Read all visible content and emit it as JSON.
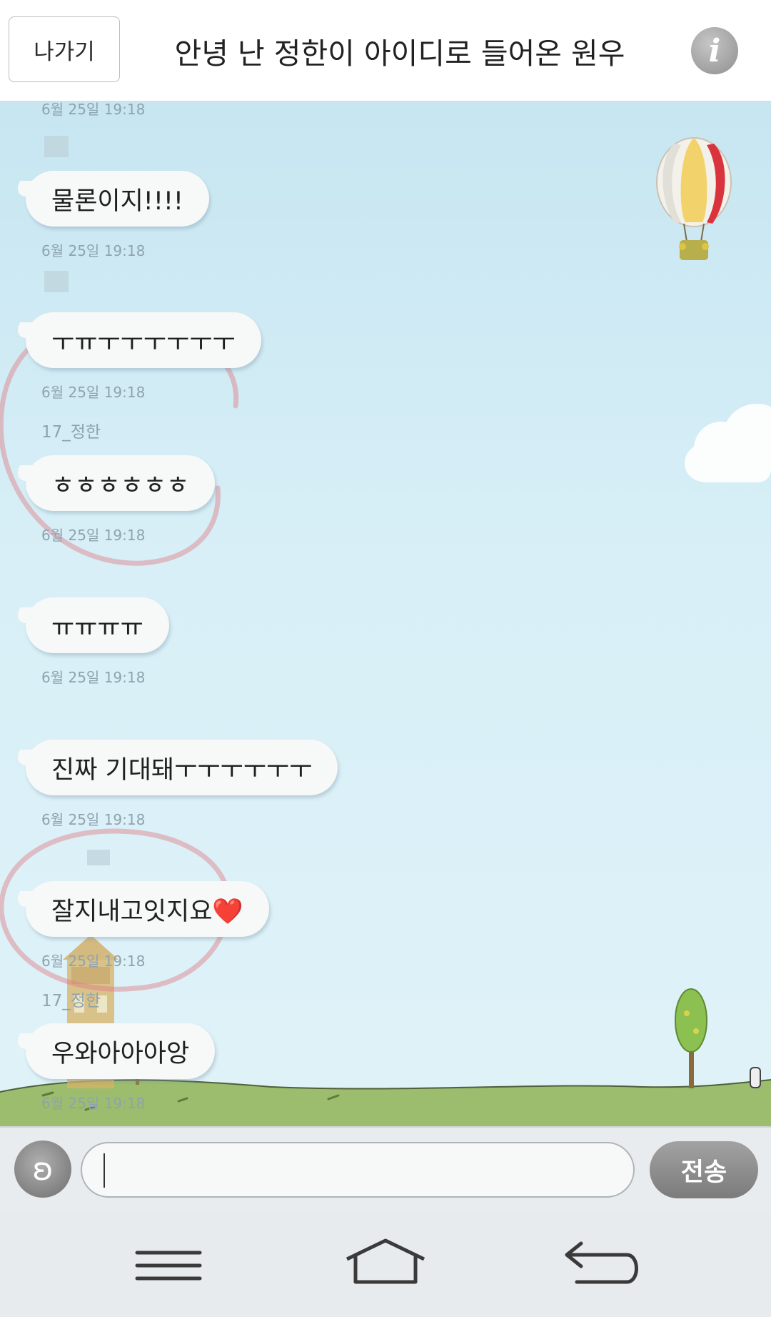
{
  "header": {
    "exit_label": "나가기",
    "title": "안녕 난 정한이 아이디로 들어온 원우",
    "info_glyph": "i"
  },
  "messages": [
    {
      "text": "물론이지!!!!",
      "time": "6월 25일 19:18"
    },
    {
      "text": "ㅜㅠㅜㅜㅜㅜㅜㅜ",
      "time": "6월 25일 19:18"
    },
    {
      "sender": "17_정한",
      "text": "ㅎㅎㅎㅎㅎㅎ",
      "time": "6월 25일 19:18"
    },
    {
      "text": "ㅠㅠㅠㅠ",
      "time": "6월 25일 19:18"
    },
    {
      "text": "진짜 기대돼ㅜㅜㅜㅜㅜㅜ",
      "time": "6월 25일 19:18"
    },
    {
      "text": "잘지내고잇지요❤️",
      "time": "6월 25일 19:18"
    },
    {
      "sender": "17_정한",
      "text": "우와아아아앙",
      "time": "6월 25일 19:18"
    }
  ],
  "top_partial_time": "6월 25일 19:18",
  "input": {
    "voice_glyph": "ʚ",
    "value": "",
    "send_label": "전송"
  },
  "icons": {
    "voice": "ear-icon",
    "info": "info-icon",
    "menu": "menu-icon",
    "home": "home-icon",
    "back": "back-icon"
  },
  "colors": {
    "sky": "#d8eff7",
    "grass": "#9cbd6e",
    "bubble": "#f7f8f8",
    "timestamp": "#8ea3ae",
    "highlight_circle": "#e07d86"
  }
}
